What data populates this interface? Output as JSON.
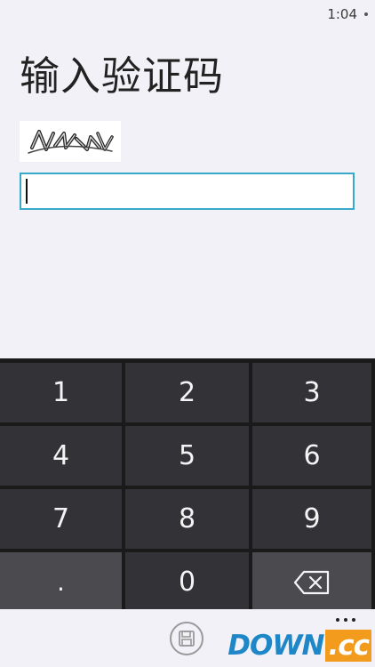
{
  "status": {
    "time": "1:04"
  },
  "title": "输入验证码",
  "captcha": {
    "alt": "验证码"
  },
  "input": {
    "value": ""
  },
  "keypad": {
    "rows": [
      [
        "1",
        "2",
        "3"
      ],
      [
        "4",
        "5",
        "6"
      ],
      [
        "7",
        "8",
        "9"
      ],
      [
        ".",
        "0",
        "backspace-icon"
      ]
    ]
  },
  "app_bar": {
    "save_icon": "save-icon",
    "more_icon": "more-icon"
  },
  "watermark": {
    "main": "DOWN",
    "tld": ".cc"
  },
  "colors": {
    "accent": "#3aa8c8",
    "keypad_bg": "#1a1a1a",
    "key": "#333236",
    "key_light": "#4b4a4f"
  }
}
